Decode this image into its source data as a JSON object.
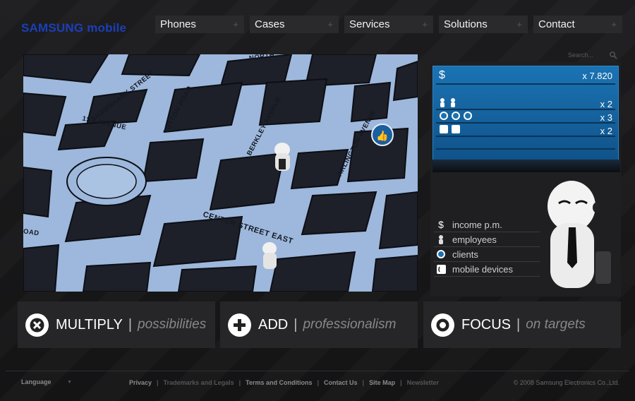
{
  "header": {
    "logo": "SAMSUNG mobile",
    "nav": [
      {
        "label": "Phones"
      },
      {
        "label": "Cases"
      },
      {
        "label": "Services"
      },
      {
        "label": "Solutions"
      },
      {
        "label": "Contact"
      }
    ],
    "nav_plus": "+",
    "search_placeholder": "Search..."
  },
  "map": {
    "streets": [
      "SHAWSHANK STREET",
      "NORTH",
      "1ST AVENUE",
      "TUTTON ROAD",
      "BERKLEY AVENUE",
      "ARLINGTON AVENUE",
      "CENTER STREET EAST",
      "OAD"
    ]
  },
  "scoreboard": {
    "income_symbol": "$",
    "income_value": "x 7.820",
    "employees_value": "x 2",
    "clients_value": "x 3",
    "devices_value": "x 2"
  },
  "legend": [
    {
      "icon": "dollar-icon",
      "label": "income p.m."
    },
    {
      "icon": "employee-icon",
      "label": "employees"
    },
    {
      "icon": "client-icon",
      "label": "clients"
    },
    {
      "icon": "mobile-device-icon",
      "label": "mobile devices"
    }
  ],
  "cards": [
    {
      "title": "MULTIPLY",
      "sep": "|",
      "subtitle": "possibilities",
      "icon": "multiply-icon"
    },
    {
      "title": "ADD",
      "sep": "|",
      "subtitle": "professionalism",
      "icon": "add-icon"
    },
    {
      "title": "FOCUS",
      "sep": "|",
      "subtitle": "on targets",
      "icon": "focus-icon"
    }
  ],
  "footer": {
    "language": "Language",
    "links": [
      "Privacy",
      "Trademarks and Legals",
      "Terms and Conditions",
      "Contact Us",
      "Site Map",
      "Newsletter"
    ],
    "separator": "|",
    "copyright": "© 2008 Samsung Electronics Co.,Ltd."
  },
  "colors": {
    "brand": "#1b3fb8",
    "map_road": "#9db8dc",
    "scoreboard": "#1b73b3"
  }
}
